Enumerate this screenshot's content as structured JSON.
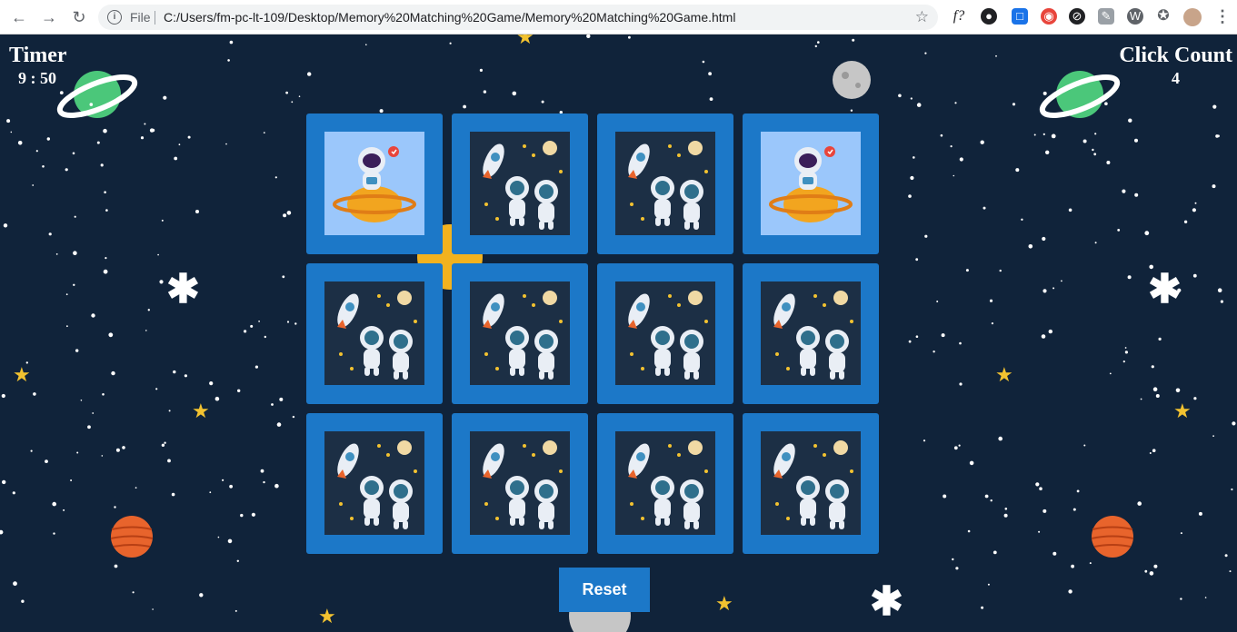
{
  "browser": {
    "back_icon": "arrow-left-icon",
    "forward_icon": "arrow-right-icon",
    "reload_icon": "reload-icon",
    "scheme": "File",
    "url": "C:/Users/fm-pc-lt-109/Desktop/Memory%20Matching%20Game/Memory%20Matching%20Game.html",
    "extensions": [
      "f?",
      "extension",
      "extension",
      "extension",
      "extension",
      "extension",
      "extension",
      "puzzle-icon",
      "profile-avatar",
      "menu-icon"
    ]
  },
  "game": {
    "timer_label": "Timer",
    "timer_value": "9 : 50",
    "click_label": "Click Count",
    "click_value": "4",
    "reset_label": "Reset",
    "cards": [
      {
        "state": "revealed",
        "image": "astronaut-on-planet"
      },
      {
        "state": "hidden",
        "image": "rocket-astronauts"
      },
      {
        "state": "hidden",
        "image": "rocket-astronauts"
      },
      {
        "state": "revealed",
        "image": "astronaut-on-planet"
      },
      {
        "state": "hidden",
        "image": "rocket-astronauts"
      },
      {
        "state": "hidden",
        "image": "rocket-astronauts"
      },
      {
        "state": "hidden",
        "image": "rocket-astronauts"
      },
      {
        "state": "hidden",
        "image": "rocket-astronauts"
      },
      {
        "state": "hidden",
        "image": "rocket-astronauts"
      },
      {
        "state": "hidden",
        "image": "rocket-astronauts"
      },
      {
        "state": "hidden",
        "image": "rocket-astronauts"
      },
      {
        "state": "hidden",
        "image": "rocket-astronauts"
      }
    ],
    "colors": {
      "background": "#10233a",
      "card": "#1c78c8",
      "card_back": "#1c2f45",
      "card_front": "#9bc7fb"
    }
  }
}
